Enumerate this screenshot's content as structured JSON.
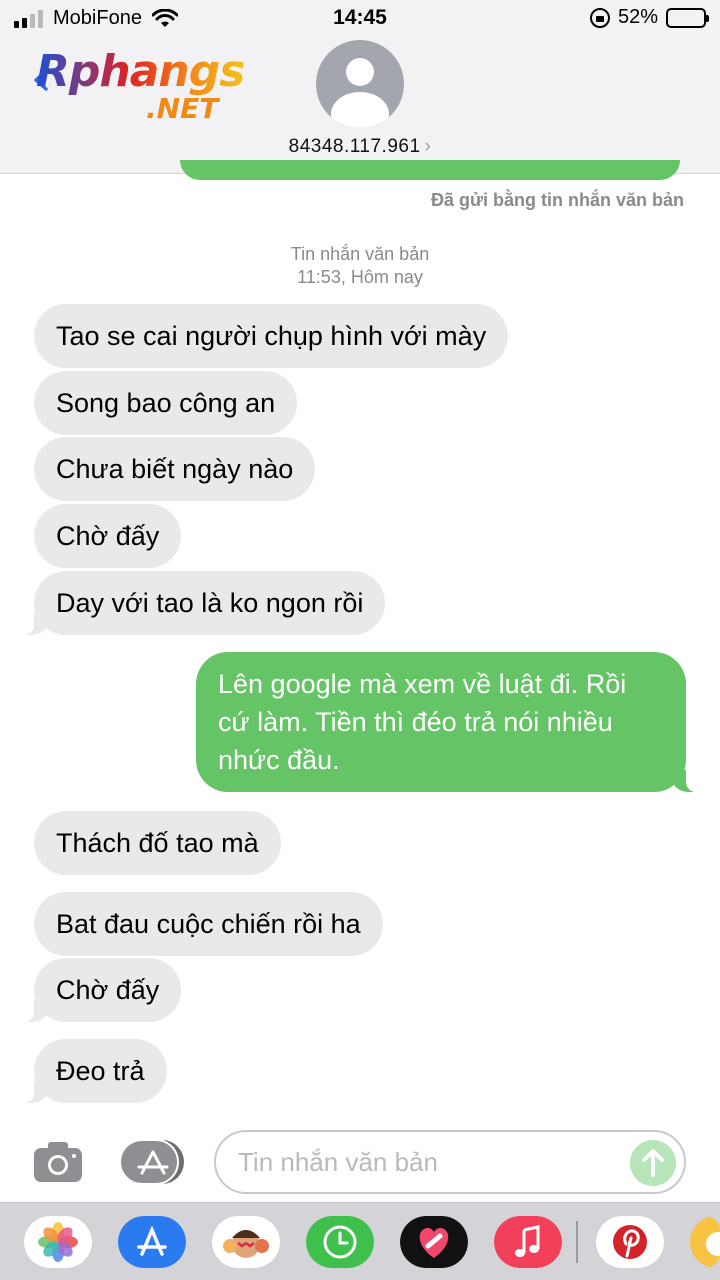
{
  "status_bar": {
    "carrier": "MobiFone",
    "time": "14:45",
    "battery_percent": "52%",
    "battery_level": 0.52,
    "signal_bars_active": 2,
    "signal_bars_total": 4
  },
  "header": {
    "logo_main": "Rphangs",
    "logo_suffix": ".NET",
    "contact_number": "84348.117.961",
    "contact_chevron": "›"
  },
  "conversation": {
    "delivery_note": "Đã gửi bằng tin nhắn văn bản",
    "meta_type": "Tin nhắn văn bản",
    "meta_time": "11:53, Hôm nay",
    "messages": [
      {
        "direction": "incoming",
        "text": "Tao se cai người chụp hình với mày"
      },
      {
        "direction": "incoming",
        "text": "Song bao công an"
      },
      {
        "direction": "incoming",
        "text": "Chưa biết ngày nào"
      },
      {
        "direction": "incoming",
        "text": "Chờ đấy"
      },
      {
        "direction": "incoming",
        "text": "Day với tao là ko ngon rồi"
      },
      {
        "direction": "outgoing",
        "text": "Lên google mà xem về luật đi. Rồi cứ làm. Tiền thì đéo trả nói nhiều nhức đầu."
      },
      {
        "direction": "incoming",
        "text": "Thách đố tao mà"
      },
      {
        "direction": "incoming",
        "text": "Bat đau cuộc chiến rồi ha"
      },
      {
        "direction": "incoming",
        "text": "Chờ đấy"
      },
      {
        "direction": "incoming",
        "text": "Đeo trả"
      }
    ]
  },
  "input_bar": {
    "placeholder": "Tin nhắn văn bản",
    "value": ""
  },
  "app_strip": {
    "apps": [
      "photos-icon",
      "app-store-icon",
      "memoji-icon",
      "screen-time-icon",
      "heart-app-icon",
      "music-icon",
      "pinterest-icon",
      "weibo-icon"
    ]
  },
  "colors": {
    "outgoing_bubble": "#65c466",
    "incoming_bubble": "#e9e9eb",
    "header_bg": "#f2f2f4",
    "meta_text": "#8a8a8e"
  }
}
